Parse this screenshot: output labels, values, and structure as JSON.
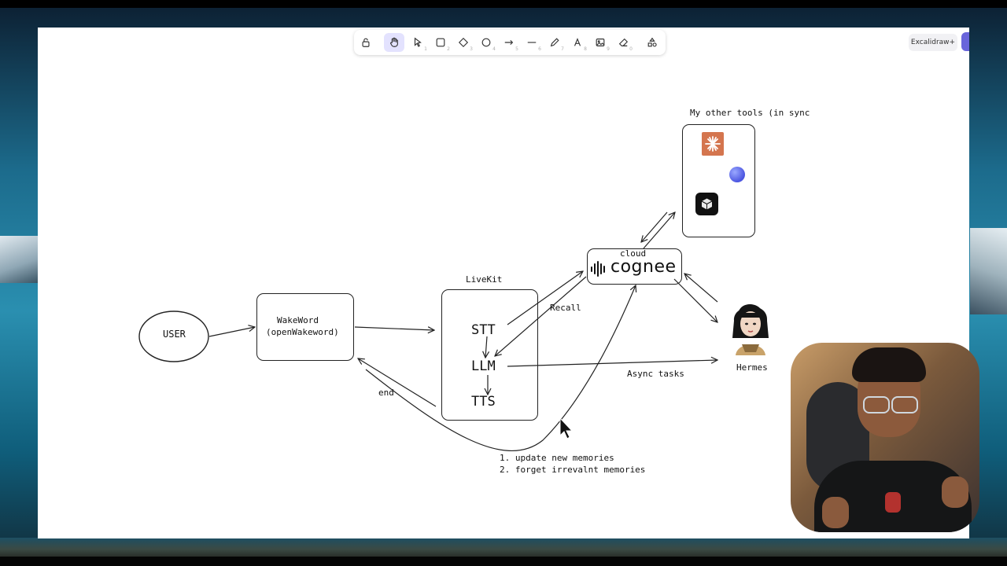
{
  "app": {
    "plan_button": "Excalidraw+"
  },
  "toolbar": {
    "tools": [
      {
        "icon": "lock-icon",
        "key": ""
      },
      {
        "icon": "hand-icon",
        "key": "",
        "active": true
      },
      {
        "icon": "select-icon",
        "key": "1"
      },
      {
        "icon": "rectangle-icon",
        "key": "2"
      },
      {
        "icon": "diamond-icon",
        "key": "3"
      },
      {
        "icon": "ellipse-icon",
        "key": "4"
      },
      {
        "icon": "arrow-icon",
        "key": "5"
      },
      {
        "icon": "line-icon",
        "key": "6"
      },
      {
        "icon": "pencil-icon",
        "key": "7"
      },
      {
        "icon": "text-icon",
        "key": "8"
      },
      {
        "icon": "image-icon",
        "key": "9"
      },
      {
        "icon": "eraser-icon",
        "key": "0"
      },
      {
        "icon": "shapes-icon",
        "key": ""
      }
    ]
  },
  "diagram": {
    "user": "USER",
    "wakeword_line1": "WakeWord",
    "wakeword_line2": "(openWakeword)",
    "livekit_title": "LiveKit",
    "stt": "STT",
    "llm": "LLM",
    "tts": "TTS",
    "recall": "Recall",
    "end": "end",
    "cloud": "cloud",
    "cognee": "cognee",
    "other_tools": "My other tools (in sync",
    "hermes": "Hermes",
    "async_tasks": "Async tasks",
    "memory_note_1": "1. update new memories",
    "memory_note_2": "2. forget irrevalnt memories"
  },
  "colors": {
    "canvas": "#ffffff",
    "accent": "#6965db",
    "claude_orange": "#d4754e",
    "stroke": "#222222"
  }
}
